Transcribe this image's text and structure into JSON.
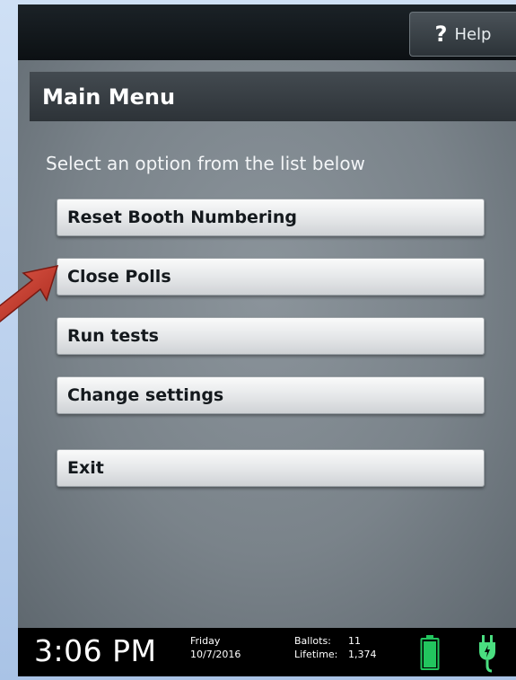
{
  "header": {
    "help_label": "Help",
    "help_icon": "?"
  },
  "menu": {
    "title": "Main Menu",
    "prompt": "Select an option from the list below",
    "items": [
      {
        "label": "Reset Booth Numbering"
      },
      {
        "label": "Close Polls"
      },
      {
        "label": "Run tests"
      },
      {
        "label": "Change settings"
      },
      {
        "label": "Exit"
      }
    ]
  },
  "status": {
    "time": "3:06 PM",
    "day": "Friday",
    "date": "10/7/2016",
    "ballots_label": "Ballots:",
    "ballots_value": "11",
    "lifetime_label": "Lifetime:",
    "lifetime_value": "1,374",
    "battery_icon": "battery-icon",
    "power_icon": "power-plug-icon"
  },
  "colors": {
    "annotation_arrow": "#c0392b",
    "battery_fill": "#22c55e",
    "plug_color": "#4ade80"
  }
}
